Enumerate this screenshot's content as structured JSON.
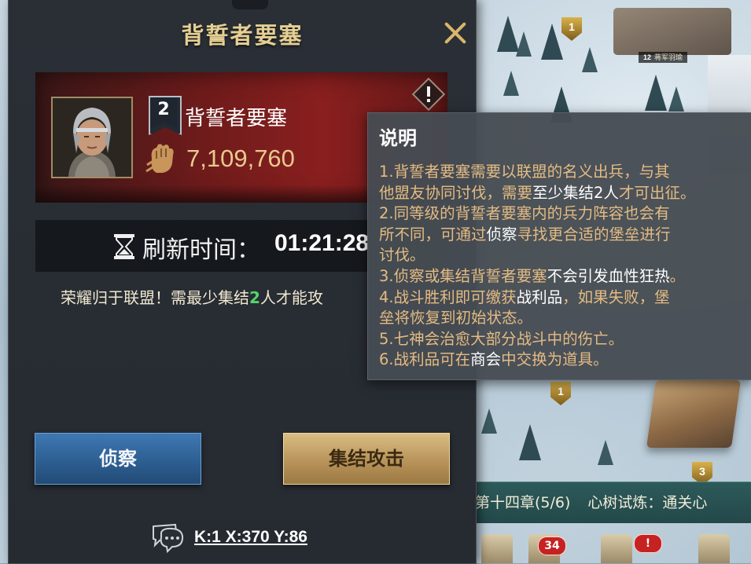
{
  "panel": {
    "title": "背誓者要塞",
    "card": {
      "level": "2",
      "name": "背誓者要塞",
      "power": "7,109,760"
    },
    "refresh": {
      "label": "刷新时间：",
      "time": "01:21:28"
    },
    "glory": {
      "before": "荣耀归于联盟！需最少集结",
      "count": "2",
      "after": "人才能攻"
    },
    "buttons": {
      "scout": "侦察",
      "rally": "集结攻击"
    },
    "coordinates": "K:1 X:370 Y:86"
  },
  "tooltip": {
    "title": "说明",
    "lines": [
      [
        {
          "t": "1.背誓者要塞需要以联盟的名义出兵，与其"
        }
      ],
      [
        {
          "t": "他盟友协同讨伐，需要"
        },
        {
          "t": "至少集结2人",
          "hl": true
        },
        {
          "t": "才可出征。"
        }
      ],
      [
        {
          "t": "2.同等级的背誓者要塞内的兵力阵容也会有"
        }
      ],
      [
        {
          "t": "所不同，可通过"
        },
        {
          "t": "侦察",
          "hl": true
        },
        {
          "t": "寻找更合适的堡垒进行"
        }
      ],
      [
        {
          "t": "讨伐。"
        }
      ],
      [
        {
          "t": "3.侦察或集结背誓者要塞"
        },
        {
          "t": "不会引发血性狂热",
          "hl": true
        },
        {
          "t": "。"
        }
      ],
      [
        {
          "t": "4.战斗胜利即可缴获"
        },
        {
          "t": "战利品",
          "hl": true
        },
        {
          "t": "，如果失败，堡"
        }
      ],
      [
        {
          "t": "垒将恢复到初始状态。"
        }
      ],
      [
        {
          "t": "5.七神会治愈大部分战斗中的伤亡。"
        }
      ],
      [
        {
          "t": "6.战利品可在"
        },
        {
          "t": "商会",
          "hl": true
        },
        {
          "t": "中交换为道具。"
        }
      ]
    ]
  },
  "map": {
    "tag_level": "12",
    "tag_name": "蒋军羽瑜",
    "markers": [
      "1",
      "1",
      "3"
    ],
    "quest": {
      "chapter": "第十四章(5/6)",
      "task": "心树试炼：通关心"
    },
    "badges": [
      "34",
      "!"
    ]
  },
  "colors": {
    "panel_bg": "#262b31",
    "title_gold": "#e6cf93",
    "tooltip_text": "#e4bb83",
    "highlight_green": "#55d36c",
    "scout_blue": "#2d5f92",
    "rally_gold": "#b8935a"
  },
  "icons": [
    "close-icon",
    "alert-icon",
    "power-fist-icon",
    "hourglass-icon",
    "chat-icon",
    "level-flag-icon"
  ]
}
